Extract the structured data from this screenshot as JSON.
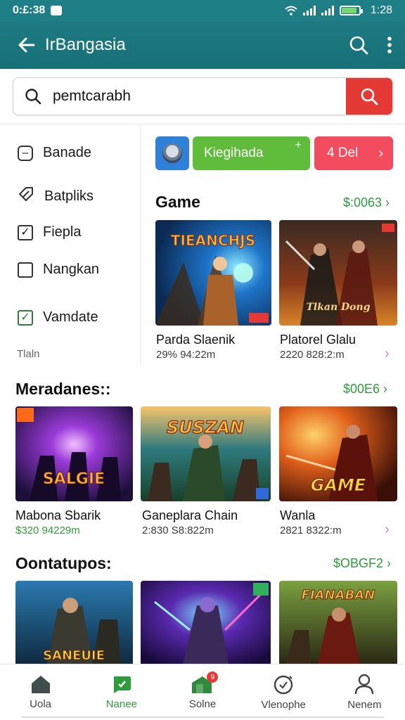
{
  "status": {
    "time": "0:£:38",
    "battery_time": "1:28"
  },
  "appbar": {
    "title": "IrBangasia",
    "back_icon": "arrow-left-icon",
    "search_icon": "search-icon",
    "more_icon": "more-vert-icon"
  },
  "search": {
    "value": "pemtcarabh",
    "placeholder": ""
  },
  "sidebar": {
    "items": [
      {
        "label": "Banade",
        "icon": "minus-square-icon"
      },
      {
        "label": "Batpliks",
        "icon": "tag-icon"
      },
      {
        "label": "Fiepla",
        "icon": "checkbox-checked-icon"
      },
      {
        "label": "Nangkan",
        "icon": "checkbox-empty-icon"
      },
      {
        "label": "Vamdate",
        "icon": "checkbox-checked-green-icon"
      }
    ],
    "footer": "Tlaln"
  },
  "chips": {
    "green_label": "Kiegihada",
    "green_plus": "+",
    "red_label": "4 Del",
    "red_arrow": "›"
  },
  "sections": [
    {
      "title": "Game",
      "link": "$:0063 ›",
      "cards": [
        {
          "title": "Parda Slaenik",
          "meta": "29% 94:22m",
          "art_text": "TIEANCHJS",
          "colors": [
            "#0b4e8a",
            "#f2a33a"
          ]
        },
        {
          "title": "Platorel Glalu",
          "meta": "2220 828:2:m",
          "art_text": "Tlkan Dong",
          "colors": [
            "#5a2a1a",
            "#e8a64a"
          ]
        }
      ]
    },
    {
      "title": "Meradanes::",
      "link": "$00E6 ›",
      "cards": [
        {
          "title": "Mabona Sbarik",
          "meta": "$320 94229m",
          "art_text": "SALGIE",
          "colors": [
            "#3a1a6a",
            "#b94ee0"
          ]
        },
        {
          "title": "Ganeplara Chain",
          "meta": "2:830 S8:822m",
          "art_text": "SUSZAN",
          "colors": [
            "#1f5a6a",
            "#f0b33a"
          ]
        },
        {
          "title": "Wanla",
          "meta": "2821 8322:m",
          "art_text": "GAME",
          "colors": [
            "#7a2a0a",
            "#ff9a2a"
          ]
        }
      ]
    },
    {
      "title": "Oontatupos:",
      "link": "$OBGF2 ›",
      "cards": [
        {
          "title": "",
          "meta": "",
          "art_text": "SANEUIE",
          "colors": [
            "#143a5a",
            "#f4c04a"
          ]
        },
        {
          "title": "",
          "meta": "",
          "art_text": "",
          "colors": [
            "#2a1a6a",
            "#38c0e0"
          ]
        },
        {
          "title": "",
          "meta": "",
          "art_text": "FIANABAN",
          "colors": [
            "#3a4a1a",
            "#f0b040"
          ]
        }
      ]
    }
  ],
  "bottom_nav": [
    {
      "label": "Uola",
      "icon": "home-icon",
      "active": false
    },
    {
      "label": "Nanee",
      "icon": "chat-icon",
      "active": true
    },
    {
      "label": "Solne",
      "icon": "store-icon",
      "active": false,
      "badge": "9"
    },
    {
      "label": "Vlenophe",
      "icon": "timer-icon",
      "active": false
    },
    {
      "label": "Nenem",
      "icon": "person-icon",
      "active": false
    }
  ]
}
